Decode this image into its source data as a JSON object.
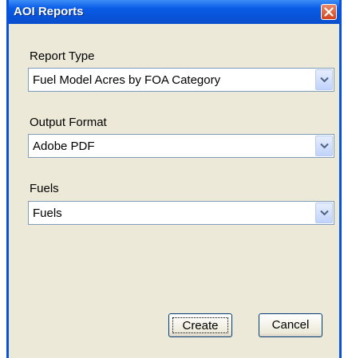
{
  "window": {
    "title": "AOI Reports"
  },
  "fields": {
    "report_type": {
      "label": "Report Type",
      "value": "Fuel Model Acres by FOA Category"
    },
    "output_format": {
      "label": "Output Format",
      "value": "Adobe PDF"
    },
    "fuels": {
      "label": "Fuels",
      "value": "Fuels"
    }
  },
  "buttons": {
    "create": "Create",
    "cancel": "Cancel"
  },
  "icons": {
    "close": "close-icon",
    "dropdown": "chevron-down-icon"
  },
  "colors": {
    "titlebar": "#0a5ce6",
    "dialog_bg": "#ece9d8",
    "close_button": "#d4421d"
  }
}
